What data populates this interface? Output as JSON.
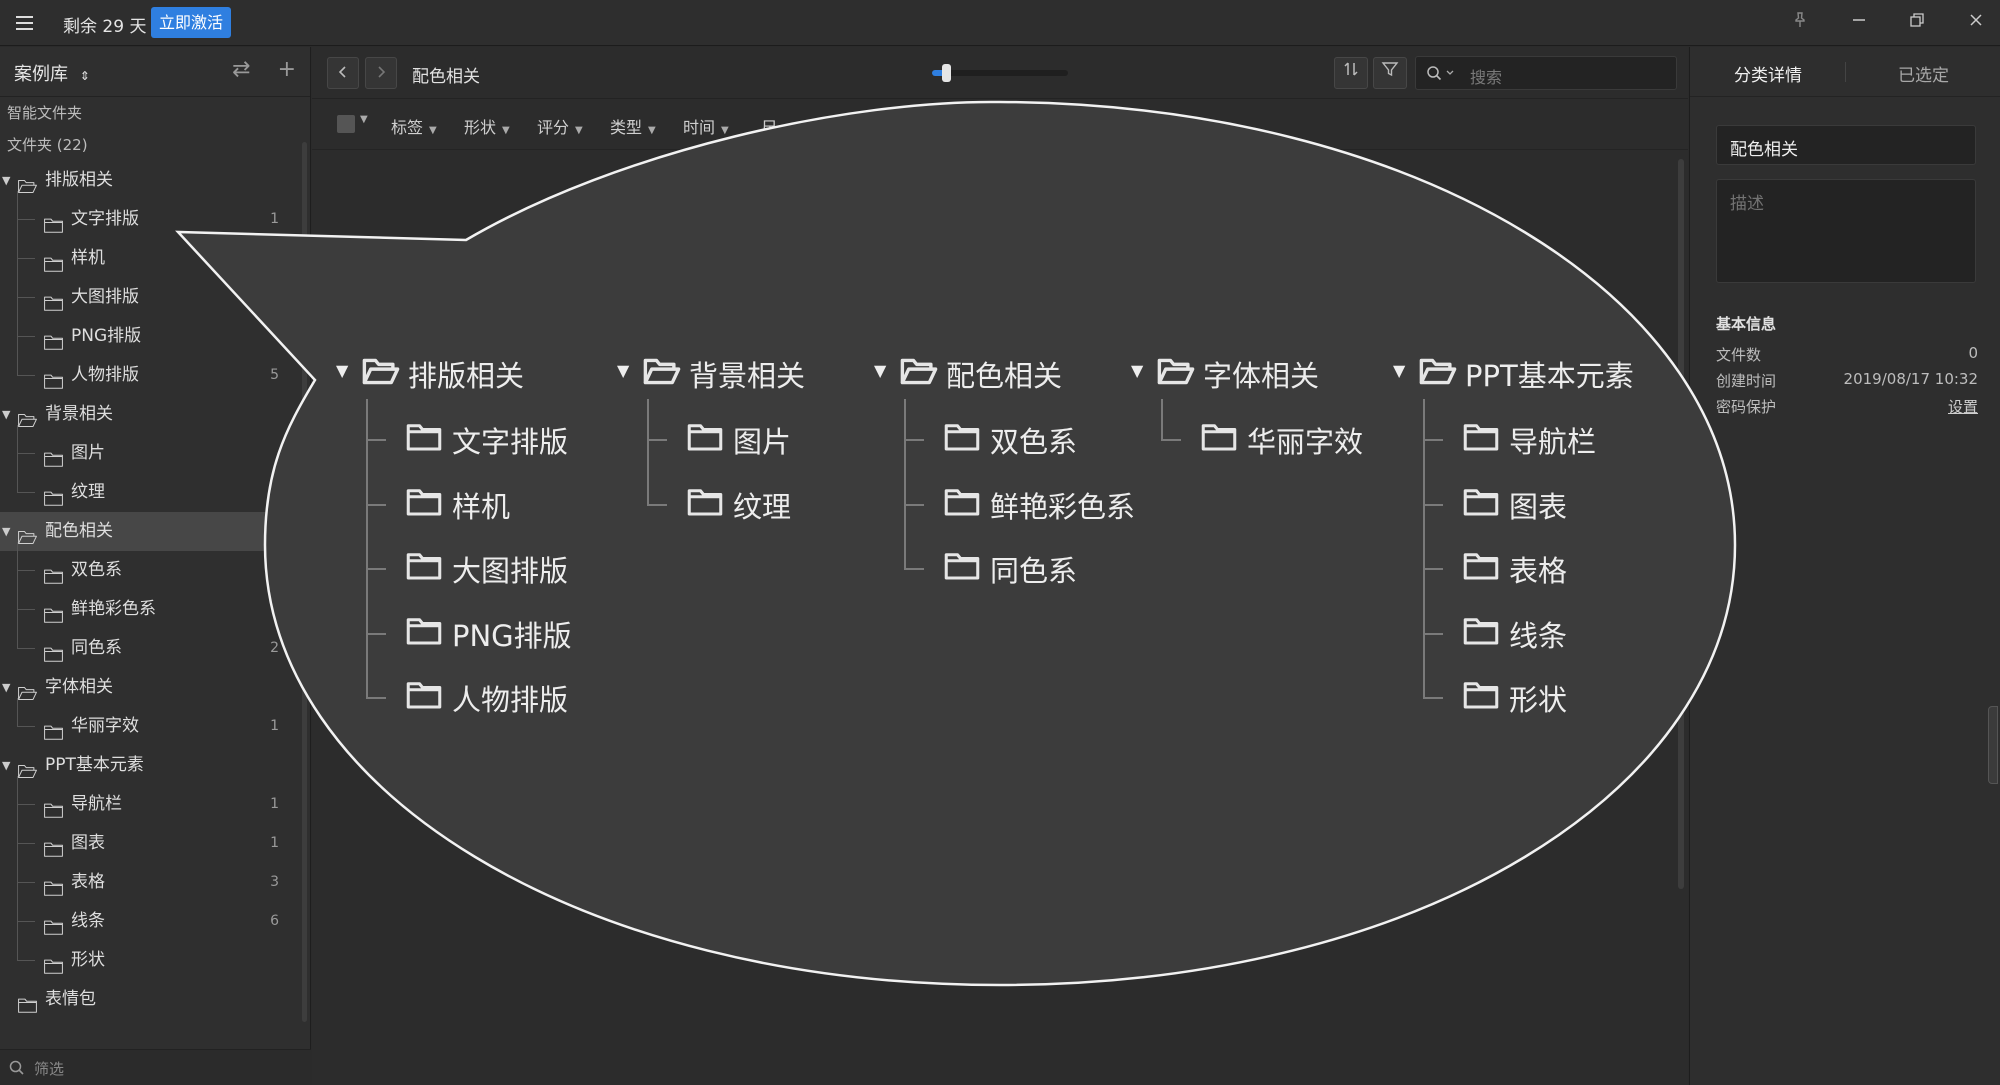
{
  "titlebar": {
    "trial_text": "剩余 29 天",
    "activate_label": "立即激活"
  },
  "sidebar": {
    "library_label": "案例库",
    "smart_folder_label": "智能文件夹",
    "folder_count_label": "文件夹 (22)",
    "filter_placeholder": "筛选",
    "tree": [
      {
        "label": "排版相关",
        "expanded": true,
        "children": [
          {
            "label": "文字排版",
            "count": "1"
          },
          {
            "label": "样机",
            "count": ""
          },
          {
            "label": "大图排版",
            "count": ""
          },
          {
            "label": "PNG排版",
            "count": ""
          },
          {
            "label": "人物排版",
            "count": "5"
          }
        ]
      },
      {
        "label": "背景相关",
        "expanded": true,
        "children": [
          {
            "label": "图片",
            "count": ""
          },
          {
            "label": "纹理",
            "count": ""
          }
        ]
      },
      {
        "label": "配色相关",
        "expanded": true,
        "selected": true,
        "children": [
          {
            "label": "双色系",
            "count": ""
          },
          {
            "label": "鲜艳彩色系",
            "count": ""
          },
          {
            "label": "同色系",
            "count": "2"
          }
        ]
      },
      {
        "label": "字体相关",
        "expanded": true,
        "children": [
          {
            "label": "华丽字效",
            "count": "1"
          }
        ]
      },
      {
        "label": "PPT基本元素",
        "expanded": true,
        "children": [
          {
            "label": "导航栏",
            "count": "1"
          },
          {
            "label": "图表",
            "count": "1"
          },
          {
            "label": "表格",
            "count": "3"
          },
          {
            "label": "线条",
            "count": "6"
          },
          {
            "label": "形状",
            "count": ""
          }
        ]
      },
      {
        "label": "表情包",
        "expanded": false,
        "children": []
      }
    ]
  },
  "main": {
    "breadcrumb": "配色相关",
    "zoom_fraction": 0.07,
    "search_placeholder": "搜索",
    "filters": [
      "标签",
      "形状",
      "评分",
      "类型",
      "时间",
      "尺"
    ]
  },
  "rpanel": {
    "tab_details": "分类详情",
    "tab_selected": "已选定",
    "name_value": "配色相关",
    "desc_placeholder": "描述",
    "info_heading": "基本信息",
    "file_count_label": "文件数",
    "file_count_value": "0",
    "created_label": "创建时间",
    "created_value": "2019/08/17 10:32",
    "password_label": "密码保护",
    "password_action": "设置"
  },
  "callout_tree": [
    {
      "label": "排版相关",
      "children": [
        "文字排版",
        "样机",
        "大图排版",
        "PNG排版",
        "人物排版"
      ]
    },
    {
      "label": "背景相关",
      "children": [
        "图片",
        "纹理"
      ]
    },
    {
      "label": "配色相关",
      "children": [
        "双色系",
        "鲜艳彩色系",
        "同色系"
      ]
    },
    {
      "label": "字体相关",
      "children": [
        "华丽字效"
      ]
    },
    {
      "label": "PPT基本元素",
      "children": [
        "导航栏",
        "图表",
        "表格",
        "线条",
        "形状"
      ]
    }
  ],
  "colors": {
    "accent": "#2f7fe0",
    "background": "#2b2b2b",
    "selected_row": "#474747"
  }
}
